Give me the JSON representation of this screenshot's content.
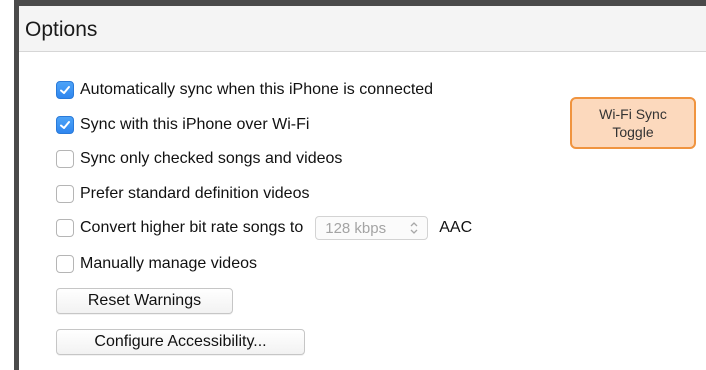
{
  "header": {
    "title": "Options"
  },
  "options": [
    {
      "label": "Automatically sync when this iPhone is connected",
      "checked": true
    },
    {
      "label": "Sync with this iPhone over Wi-Fi",
      "checked": true
    },
    {
      "label": "Sync only checked songs and videos",
      "checked": false
    },
    {
      "label": "Prefer standard definition videos",
      "checked": false
    },
    {
      "label": "Convert higher bit rate songs to",
      "checked": false,
      "bitrate": "128 kbps",
      "format": "AAC"
    },
    {
      "label": "Manually manage videos",
      "checked": false
    }
  ],
  "buttons": {
    "reset_warnings": "Reset Warnings",
    "configure_accessibility": "Configure Accessibility..."
  },
  "annotation": {
    "line1": "Wi-Fi Sync",
    "line2": "Toggle"
  },
  "colors": {
    "checkbox_on": "#3b8ff2",
    "annotation_fill": "#fcd9bd",
    "annotation_border": "#f0943f"
  }
}
